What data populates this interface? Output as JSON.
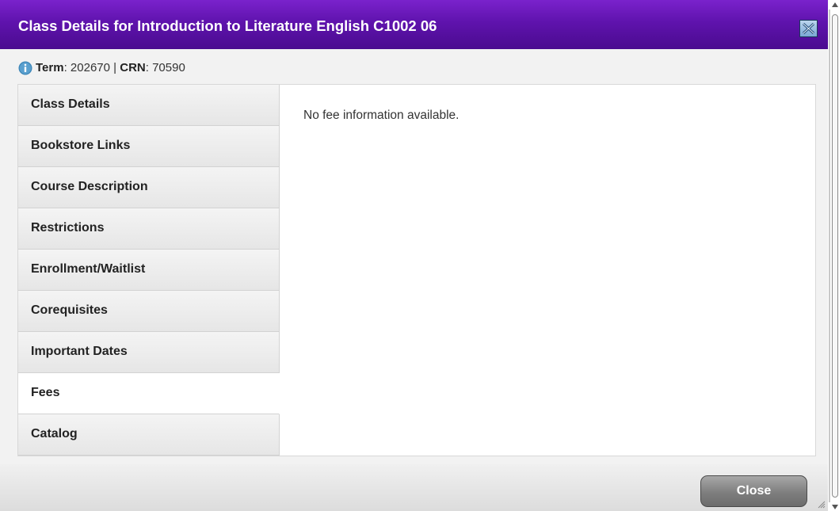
{
  "dialog": {
    "title": "Class Details for Introduction to Literature English C1002 06",
    "close_icon": "close-x-icon",
    "term_label": "Term",
    "term_value": "202670",
    "separator": "|",
    "crn_label": "CRN",
    "crn_value": "70590",
    "info_icon": "info-icon"
  },
  "tabs": [
    {
      "label": "Class Details",
      "active": false
    },
    {
      "label": "Bookstore Links",
      "active": false
    },
    {
      "label": "Course Description",
      "active": false
    },
    {
      "label": "Restrictions",
      "active": false
    },
    {
      "label": "Enrollment/Waitlist",
      "active": false
    },
    {
      "label": "Corequisites",
      "active": false
    },
    {
      "label": "Important Dates",
      "active": false
    },
    {
      "label": "Fees",
      "active": true
    },
    {
      "label": "Catalog",
      "active": false
    }
  ],
  "content": {
    "message": "No fee information available."
  },
  "footer": {
    "close_label": "Close"
  },
  "colors": {
    "title_bar": "#5f13ad",
    "info_icon": "#3d86b8",
    "close_button": "#7e7e7e"
  }
}
